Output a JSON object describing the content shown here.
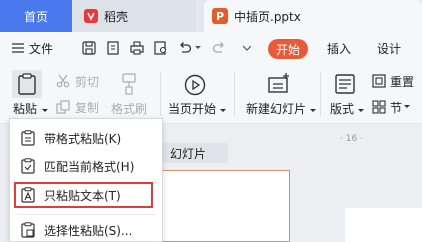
{
  "tabs": {
    "home": "首页",
    "wps": "稻壳",
    "doc": "中插页.pptx",
    "doc_badge": "P"
  },
  "menubar": {
    "file": "文件",
    "start": "开始",
    "insert": "插入",
    "design": "设计"
  },
  "ribbon": {
    "paste": "粘贴",
    "cut": "剪切",
    "copy": "复制",
    "format_painter": "格式刷",
    "from_current": "当页开始",
    "new_slide": "新建幻灯片",
    "layout": "版式",
    "reset": "重置",
    "section": "节"
  },
  "paste_menu": {
    "items": [
      {
        "label": "带格式粘贴(K)",
        "icon": "paste-icon"
      },
      {
        "label": "匹配当前格式(H)",
        "icon": "paste-match-icon"
      },
      {
        "label": "只粘贴文本(T)",
        "icon": "paste-text-icon"
      },
      {
        "label": "选择性粘贴(S)...",
        "icon": "paste-special-icon"
      }
    ]
  },
  "doc_area": {
    "slide_tab": "幻灯片",
    "ruler": "· 16 ·"
  },
  "colors": {
    "accent_blue": "#4a79ee",
    "start_orange": "#e85a3a",
    "highlight_red": "#e23b3b"
  }
}
